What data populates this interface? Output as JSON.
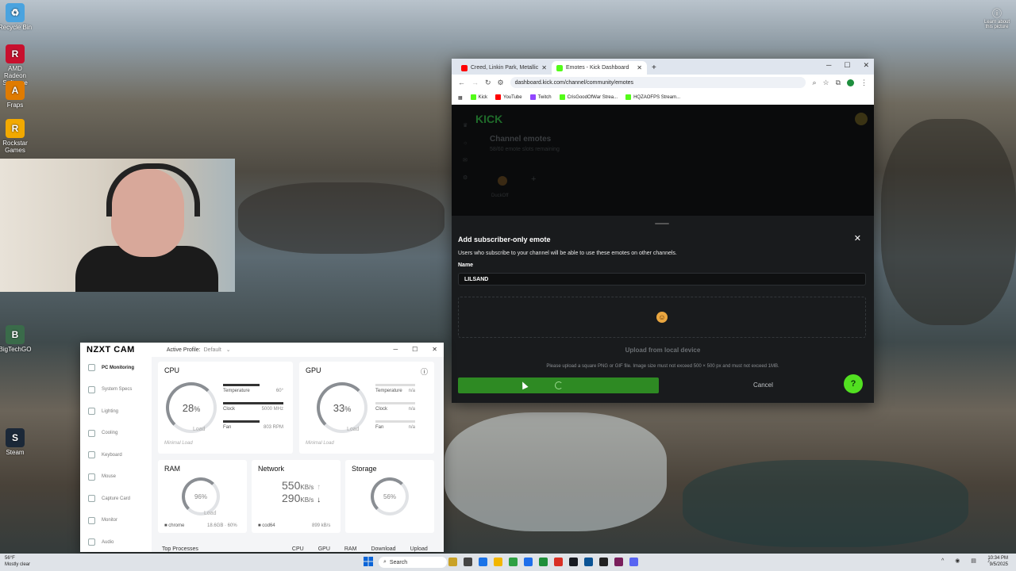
{
  "desktop": {
    "icons": [
      {
        "label": "Recycle Bin",
        "color": "#4aa3df",
        "glyph": "♻"
      },
      {
        "label": "AMD Radeon Software",
        "color": "#c8102e",
        "glyph": "R"
      },
      {
        "label": "Fraps",
        "color": "#e07b00",
        "glyph": "A"
      },
      {
        "label": "Rockstar Games",
        "color": "#f2a900",
        "glyph": "R"
      },
      {
        "label": "Steam",
        "color": "#1b2838",
        "glyph": "S"
      },
      {
        "label": "BigTechGO",
        "color": "#3a6b4a",
        "glyph": "B"
      }
    ],
    "learn_about": "Learn about this picture"
  },
  "browser": {
    "tabs": [
      {
        "label": "Creed, Linkin Park, Metallic",
        "favicon_color": "#ff0000",
        "active": false
      },
      {
        "label": "Emotes - Kick Dashboard",
        "favicon_color": "#53fc18",
        "active": true
      }
    ],
    "new_tab": "+",
    "url": "dashboard.kick.com/channel/community/emotes",
    "bookmarks": [
      {
        "label": "Kick",
        "color": "#53fc18"
      },
      {
        "label": "YouTube",
        "color": "#ff0000"
      },
      {
        "label": "Twitch",
        "color": "#9146ff"
      },
      {
        "label": "CrisGoodOfWar Strea...",
        "color": "#53fc18"
      },
      {
        "label": "HQZAOFPS Stream...",
        "color": "#53fc18"
      }
    ]
  },
  "kick": {
    "logo": "KICK",
    "section_title": "Channel emotes",
    "section_subtitle": "58/60 emote slots remaining",
    "existing_emote": "DuckOff",
    "modal": {
      "title": "Add subscriber-only emote",
      "description": "Users who subscribe to your channel will be able to use these emotes on other channels.",
      "name_label": "Name",
      "name_value": "LILSAND",
      "upload_label": "Upload from local device",
      "hint": "Please upload a square PNG or GIF file. Image size must not exceed 500 × 500 px and must not exceed 1MB.",
      "cancel": "Cancel"
    }
  },
  "nzxt": {
    "logo": "NZXT CAM",
    "profile_label": "Active Profile:",
    "profile_value": "Default",
    "nav": [
      "PC Monitoring",
      "System Specs",
      "Lighting",
      "Cooling",
      "Keyboard",
      "Mouse",
      "Capture Card",
      "Monitor",
      "Audio"
    ],
    "cpu": {
      "title": "CPU",
      "load": "28",
      "unit": "%",
      "load_label": "Load",
      "temp_label": "Temperature",
      "temp_val": "60°",
      "clock_label": "Clock",
      "clock_val": "5000 MHz",
      "fan_label": "Fan",
      "fan_val": "803 RPM",
      "status": "Minimal Load"
    },
    "gpu": {
      "title": "GPU",
      "load": "33",
      "unit": "%",
      "load_label": "Load",
      "temp_label": "Temperature",
      "temp_val": "n/a",
      "clock_label": "Clock",
      "clock_val": "n/a",
      "fan_label": "Fan",
      "fan_val": "n/a",
      "status": "Minimal Load"
    },
    "ram": {
      "title": "RAM",
      "value": "96%",
      "load_label": "Load",
      "process": "chrome",
      "detail": "18.6GB · 60%"
    },
    "network": {
      "title": "Network",
      "down": "550",
      "up": "290",
      "unit": "KB/s",
      "process": "cod64",
      "detail": "899 kB/s"
    },
    "storage": {
      "title": "Storage",
      "value": "56%"
    },
    "footer": {
      "label": "Top Processes",
      "cols": [
        "CPU",
        "GPU",
        "RAM",
        "Download",
        "Upload"
      ]
    }
  },
  "taskbar": {
    "weather_temp": "56°F",
    "weather_desc": "Mostly clear",
    "search": "Search",
    "time": "10:34 PM",
    "date": "9/5/2025"
  }
}
